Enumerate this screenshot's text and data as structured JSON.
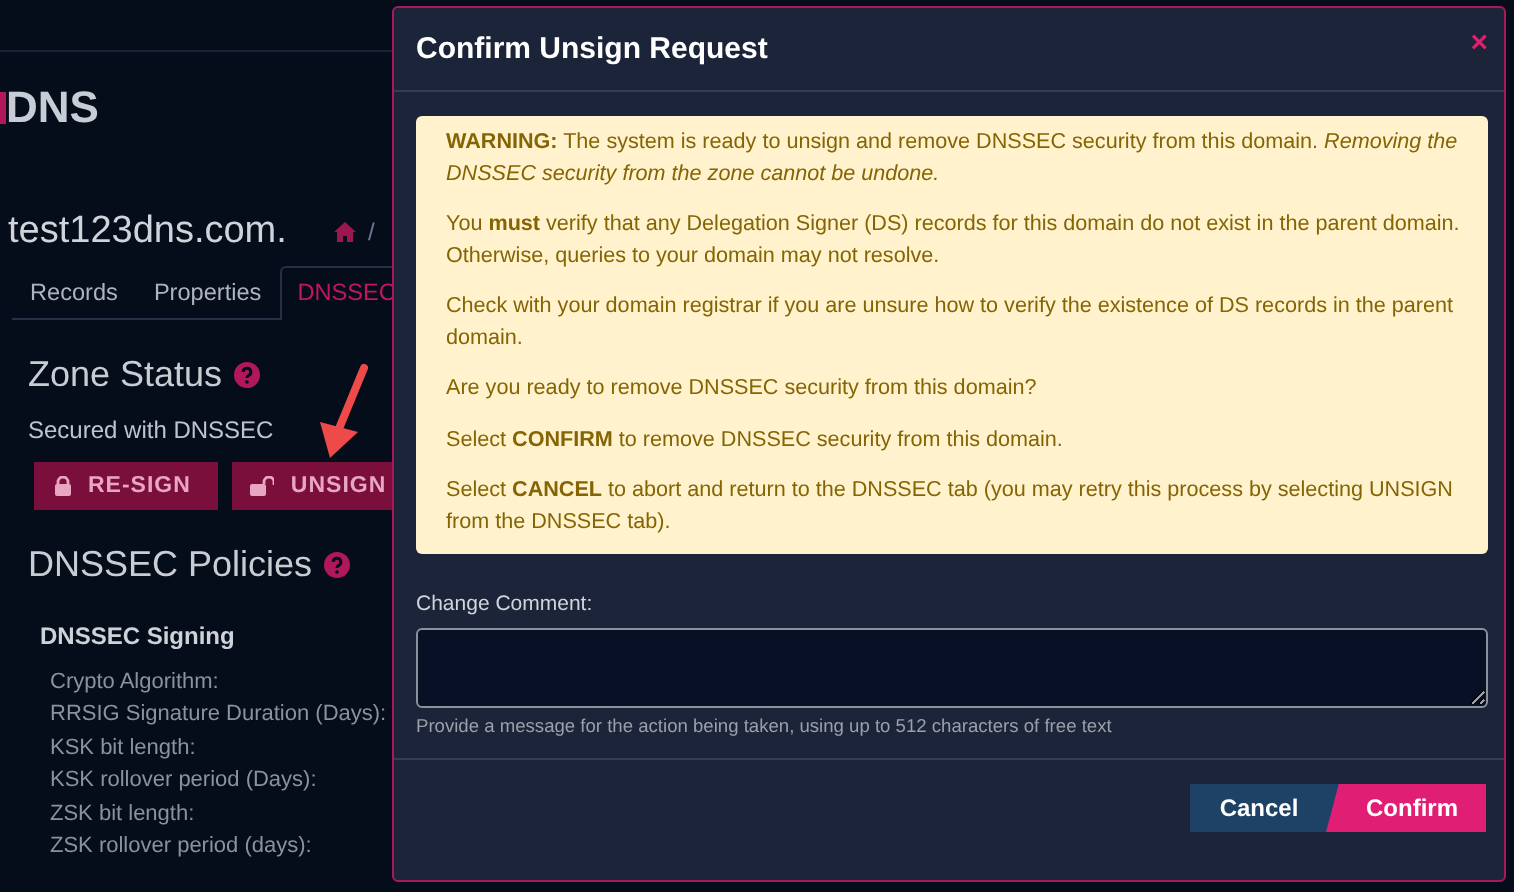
{
  "page": {
    "brand": "DNS",
    "domain": "test123dns.com.",
    "breadcrumb_separator": "/",
    "tabs": [
      {
        "label": "Records",
        "selected": false
      },
      {
        "label": "Properties",
        "selected": false
      },
      {
        "label": "DNSSEC",
        "selected": true
      }
    ],
    "zone_status": {
      "heading": "Zone Status",
      "status": "Secured with DNSSEC",
      "buttons": [
        {
          "label": "RE-SIGN",
          "kind": "lock"
        },
        {
          "label": "UNSIGN",
          "kind": "unlock"
        }
      ]
    },
    "policies": {
      "heading": "DNSSEC Policies",
      "section": "DNSSEC Signing",
      "fields": [
        "Crypto Algorithm:",
        "RRSIG Signature Duration (Days):",
        "KSK bit length:",
        "KSK rollover period (Days):",
        "ZSK bit length:",
        "ZSK rollover period (days):"
      ]
    }
  },
  "modal": {
    "title": "Confirm Unsign Request",
    "close": "×",
    "warning": [
      "**WARNING:** The system is ready to unsign and remove DNSSEC security from this domain. *Removing the DNSSEC security from the zone cannot be undone.*",
      "You **must** verify that any Delegation Signer (DS) records for this domain do not exist in the parent domain. Otherwise, queries to your domain may not resolve.",
      "Check with your domain registrar if you are unsure how to verify the existence of DS records in the parent domain.",
      "Are you ready to remove DNSSEC security from this domain?",
      "Select **CONFIRM** to remove DNSSEC security from this domain.",
      "Select **CANCEL** to abort and return to the DNSSEC tab (you may retry this process by selecting UNSIGN from the DNSSEC tab)."
    ],
    "comment_label": "Change Comment:",
    "comment_help": "Provide a message for the action being taken, using up to 512 characters of free text",
    "buttons": [
      {
        "label": "Cancel",
        "kind": "secondary"
      },
      {
        "label": "Confirm",
        "kind": "primary"
      }
    ]
  }
}
